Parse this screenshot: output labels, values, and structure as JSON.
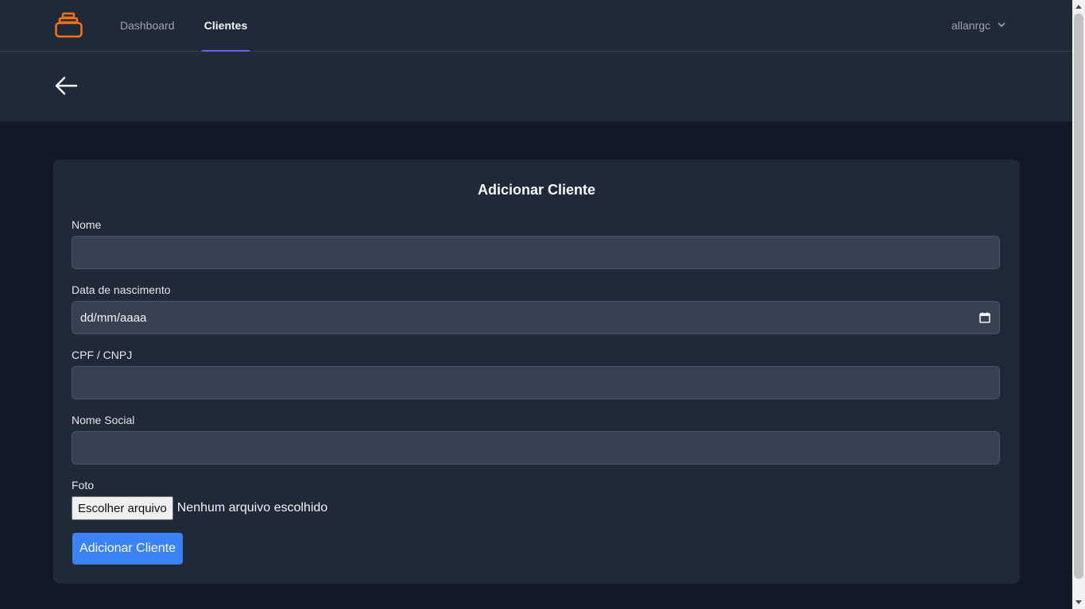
{
  "nav": {
    "logo_icon": "stack-logo-icon",
    "links": [
      {
        "label": "Dashboard",
        "active": false
      },
      {
        "label": "Clientes",
        "active": true
      }
    ],
    "user": {
      "name": "allanrgc",
      "icon": "chevron-down-icon"
    }
  },
  "subheader": {
    "back_icon": "arrow-left-icon"
  },
  "form": {
    "title": "Adicionar Cliente",
    "fields": {
      "nome": {
        "label": "Nome",
        "value": ""
      },
      "nascimento": {
        "label": "Data de nascimento",
        "placeholder": "dd/mm/aaaa"
      },
      "cpf": {
        "label": "CPF / CNPJ",
        "value": ""
      },
      "nome_social": {
        "label": "Nome Social",
        "value": ""
      },
      "foto": {
        "label": "Foto",
        "button": "Escolher arquivo",
        "status": "Nenhum arquivo escolhido"
      }
    },
    "submit_label": "Adicionar Cliente"
  },
  "colors": {
    "background": "#111827",
    "surface": "#1f2937",
    "input": "#374151",
    "accent": "#3b82f6",
    "nav_indicator": "#6366f1",
    "logo": "#f97316"
  }
}
